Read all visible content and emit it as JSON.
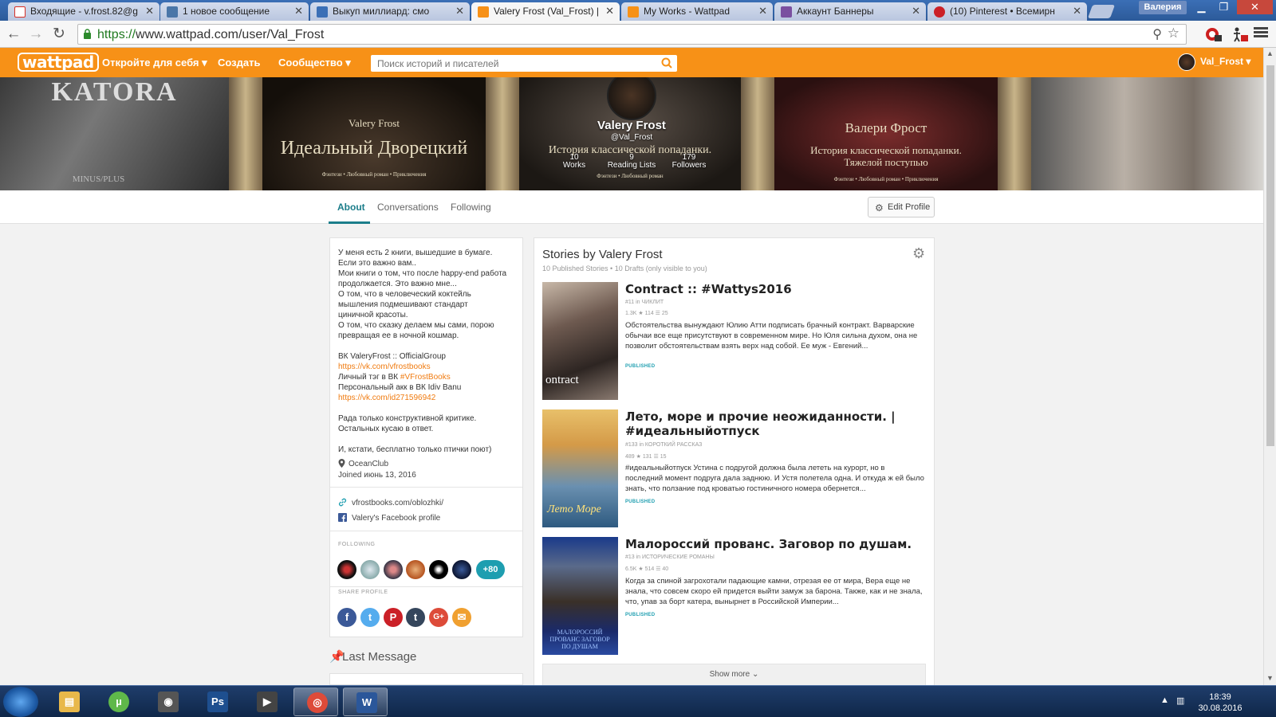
{
  "browser": {
    "tabs": [
      {
        "label": "Входящие - v.frost.82@g",
        "icon_color": "#d93025"
      },
      {
        "label": "1 новое сообщение",
        "icon_color": "#4a76a8"
      },
      {
        "label": "Выкуп миллиард: смо",
        "icon_color": "#3b6fb6"
      },
      {
        "label": "Valery Frost (Val_Frost) | F",
        "icon_color": "#f79117"
      },
      {
        "label": "My Works - Wattpad",
        "icon_color": "#f79117"
      },
      {
        "label": "Аккаунт Баннеры",
        "icon_color": "#7a4fa0"
      },
      {
        "label": "(10) Pinterest • Всемирн",
        "icon_color": "#cb2027"
      }
    ],
    "window_user": "Валерия",
    "url_secure": "https://",
    "url_rest": "www.wattpad.com/user/Val_Frost"
  },
  "nav": {
    "logo": "wattpad",
    "discover": "Откройте для себя ▾",
    "create": "Создать",
    "community": "Сообщество ▾",
    "search_placeholder": "Поиск историй и писателей",
    "username": "Val_Frost ▾"
  },
  "banner": {
    "covers": [
      {
        "title": "KATORA",
        "sub": "MINUS/PLUS"
      },
      {
        "title": "Идеальный Дворецкий",
        "author": "Valery Frost",
        "sub": "Фэнтези • Любовный роман • Приключения"
      },
      {
        "title": "История классической попаданки.",
        "sub": "Фэнтези • Любовный роман"
      },
      {
        "title": "История классической попаданки. Тяжелой поступью",
        "author": "Валери Фрост",
        "sub": "Фэнтези • Любовный роман • Приключения"
      }
    ]
  },
  "profile": {
    "name": "Valery Frost",
    "handle": "@Val_Frost",
    "stats": [
      {
        "value": "10",
        "label": "Works"
      },
      {
        "value": "9",
        "label": "Reading Lists"
      },
      {
        "value": "179",
        "label": "Followers"
      }
    ]
  },
  "subnav": {
    "tabs": [
      "About",
      "Conversations",
      "Following"
    ],
    "edit": "Edit Profile"
  },
  "about": {
    "bio_lines": [
      "У меня есть 2 книги, вышедшие в бумаге.",
      "Если это важно вам..",
      "Мои книги о том, что после happy-end работа",
      "продолжается. Это важно мне...",
      "О том, что в человеческий коктейль",
      "мышления подмешивают стандарт",
      "циничной красоты.",
      "О том, что сказку делаем мы сами, порою",
      "превращая ее в ночной кошмар."
    ],
    "vk_group": "ВК ValeryFrost :: OfficialGroup",
    "vk_group_link": "https://vk.com/vfrostbooks",
    "tag_prefix": "Личный тэг в ВК ",
    "tag": "#VFrostBooks",
    "personal": "Персональный акк в ВК Idiv Banu",
    "personal_link": "https://vk.com/id271596942",
    "critique_1": "Рада только конструктивной критике.",
    "critique_2": "Остальных кусаю в ответ.",
    "note": "И, кстати, бесплатно только птички поют)",
    "location": "OceanClub",
    "joined": "Joined июнь 13, 2016",
    "website": "vfrostbooks.com/oblozhki/",
    "facebook": "Valery's Facebook profile",
    "followings_label": "FOLLOWING",
    "followings_more": "+80",
    "share_label": "SHARE PROFILE",
    "share_buttons": [
      {
        "glyph": "f",
        "color": "#3b5998"
      },
      {
        "glyph": "t",
        "color": "#55acee"
      },
      {
        "glyph": "P",
        "color": "#cb2027"
      },
      {
        "glyph": "t",
        "color": "#35465c"
      },
      {
        "glyph": "G+",
        "color": "#dd4b39"
      },
      {
        "glyph": "✉",
        "color": "#f0a030"
      }
    ],
    "last_message": "Last Message"
  },
  "stories": {
    "title": "Stories by Valery Frost",
    "subtitle": "10 Published Stories • 10 Drafts (only visible to you)",
    "items": [
      {
        "title": "Contract :: #Wattys2016",
        "rank": "#11 in ЧИКЛИТ",
        "stats": "1.3K ★ 114 ☰ 25",
        "desc": "Обстоятельства вынуждают Юлию Атти подписать брачный контракт. Варварские обычаи все еще присутствуют в современном мире. Но Юля сильна духом, она не позволит обстоятельствам взять верх над собой. Ее муж - Евгений...",
        "status": "PUBLISHED",
        "cover_text": "ontract"
      },
      {
        "title": "Лето, море и прочие неожиданности. | #идеальныйотпуск",
        "rank": "#133 in КОРОТКИЙ РАССКАЗ",
        "stats": "489 ★ 131 ☰ 15",
        "desc": "#идеальныйотпуск Устина с подругой должна была лететь на курорт, но в последний момент подруга дала заднюю. И Устя полетела одна. И откуда ж ей было знать, что ползание под кроватью гостиничного номера обернется...",
        "status": "PUBLISHED",
        "cover_text": "Лето Море"
      },
      {
        "title": "Малороссий прованс. Заговор по душам.",
        "rank": "#13 in ИСТОРИЧЕСКИЕ РОМАНЫ",
        "stats": "6.5K ★ 514 ☰ 40",
        "desc": "Когда за спиной загрохотали падающие камни, отрезая ее от мира, Вера еще не знала, что совсем скоро ей придется выйти замуж за барона. Также, как и не знала, что, упав за борт катера, вынырнет в Российской Империи...",
        "status": "PUBLISHED",
        "cover_text": "МАЛОРОССИЙ ПРОВАНС ЗАГОВОР ПО ДУШАМ"
      }
    ],
    "show_more": "Show more ⌄"
  },
  "taskbar": {
    "apps": [
      {
        "name": "explorer",
        "glyph": "▤",
        "color": "#e8b84a"
      },
      {
        "name": "utorrent",
        "glyph": "µ",
        "color": "#5fb84a"
      },
      {
        "name": "camera",
        "glyph": "◉",
        "color": "#555555"
      },
      {
        "name": "photoshop",
        "glyph": "Ps",
        "color": "#1e4f8f"
      },
      {
        "name": "media",
        "glyph": "▶",
        "color": "#444444"
      },
      {
        "name": "chrome",
        "glyph": "◎",
        "color": "#dd4b39"
      },
      {
        "name": "word",
        "glyph": "W",
        "color": "#2b579a"
      }
    ],
    "time": "18:39",
    "date": "30.08.2016"
  }
}
